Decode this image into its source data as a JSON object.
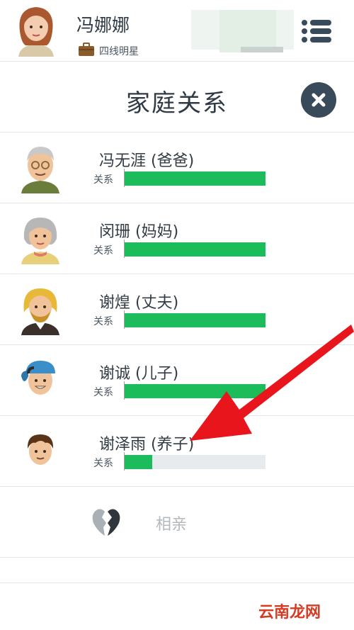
{
  "header": {
    "name": "冯娜娜",
    "job": "四线明星",
    "menu_icon": "list-menu-icon"
  },
  "dialog": {
    "title": "家庭关系",
    "close_icon": "close-icon"
  },
  "relation_label": "关系",
  "family": [
    {
      "name": "冯无涯 (爸爸)",
      "relation": 1.0,
      "avatar": "elderly-man-avatar"
    },
    {
      "name": "闵珊 (妈妈)",
      "relation": 1.0,
      "avatar": "elderly-woman-avatar"
    },
    {
      "name": "谢煌 (丈夫)",
      "relation": 1.0,
      "avatar": "bearded-man-avatar"
    },
    {
      "name": "谢诚 (儿子)",
      "relation": 1.0,
      "avatar": "boy-cap-avatar"
    },
    {
      "name": "谢泽雨 (养子)",
      "relation": 0.2,
      "avatar": "boy-avatar"
    }
  ],
  "extra": {
    "label": "相亲",
    "icon": "broken-heart-icon"
  },
  "watermark": "云南龙网",
  "colors": {
    "bar": "#1dbc5a",
    "track": "#e8ebee",
    "dark": "#394a5b",
    "arrow": "#e8151c"
  }
}
